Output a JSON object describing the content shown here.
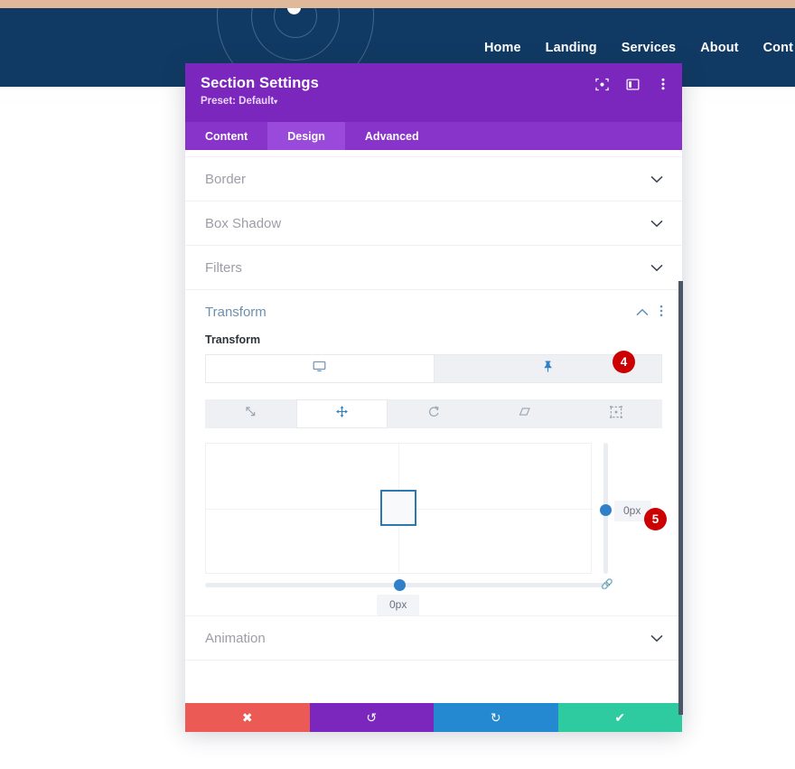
{
  "site": {
    "nav": [
      {
        "label": "Home"
      },
      {
        "label": "Landing"
      },
      {
        "label": "Services"
      },
      {
        "label": "About"
      },
      {
        "label": "Cont"
      }
    ]
  },
  "modal": {
    "title": "Section Settings",
    "preset": "Preset: Default",
    "preset_caret": "▾",
    "header_icons": [
      {
        "name": "focus-icon"
      },
      {
        "name": "layout-icon"
      },
      {
        "name": "kebab-menu-icon"
      }
    ],
    "tabs": [
      {
        "label": "Content",
        "active": false
      },
      {
        "label": "Design",
        "active": true
      },
      {
        "label": "Advanced",
        "active": false
      }
    ],
    "accordions_before": [
      {
        "label": "Border"
      },
      {
        "label": "Box Shadow"
      },
      {
        "label": "Filters"
      }
    ],
    "accordions_after": [
      {
        "label": "Animation"
      }
    ],
    "transform": {
      "section_label": "Transform",
      "field_label": "Transform",
      "device_tabs": [
        {
          "icon": "desktop-icon",
          "active": true
        },
        {
          "icon": "pin-icon",
          "active": false
        }
      ],
      "type_tabs": [
        {
          "icon": "scale-icon",
          "active": false
        },
        {
          "icon": "move-icon",
          "active": true
        },
        {
          "icon": "rotate-icon",
          "active": false
        },
        {
          "icon": "skew-icon",
          "active": false
        },
        {
          "icon": "origin-icon",
          "active": false
        }
      ],
      "vertical_value": "0px",
      "horizontal_value": "0px"
    },
    "footer": [
      {
        "name": "cancel-button",
        "icon": "✖",
        "class": "cancel"
      },
      {
        "name": "undo-button",
        "icon": "↺",
        "class": "undo"
      },
      {
        "name": "redo-button",
        "icon": "↻",
        "class": "redo"
      },
      {
        "name": "save-button",
        "icon": "✔",
        "class": "save"
      }
    ]
  },
  "badges": [
    {
      "label": "4"
    },
    {
      "label": "5"
    }
  ],
  "colors": {
    "modal_header": "#7b27be",
    "tab_active": "#9a4ada",
    "badge": "#cc0000",
    "accent_blue": "#2f80c8",
    "site_header": "#103a63",
    "top_strip": "#dfb999"
  }
}
